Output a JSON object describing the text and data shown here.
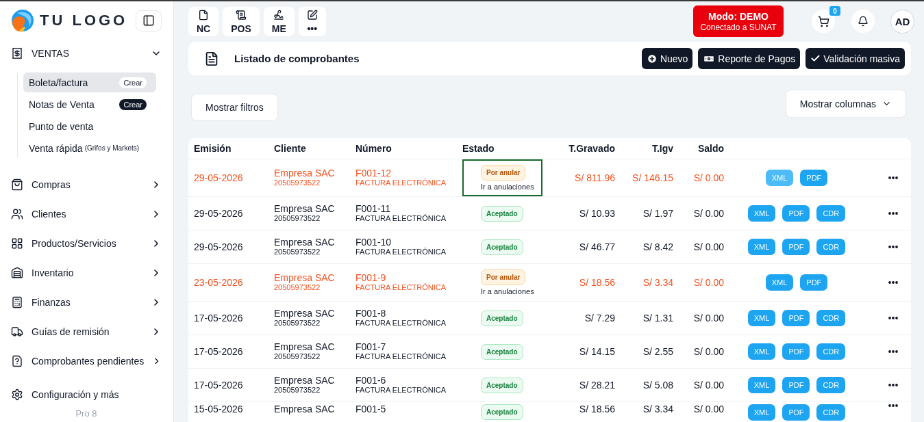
{
  "sidebar": {
    "logo": "TU LOGO",
    "menu": [
      {
        "kind": "group",
        "label": "VENTAS",
        "expanded": true,
        "children": [
          {
            "label": "Boleta/factura",
            "selected": true,
            "badge": "Crear"
          },
          {
            "label": "Notas de Venta",
            "selected": false,
            "badge": "Crear"
          },
          {
            "label": "Punto de venta",
            "selected": false
          },
          {
            "label": "Venta rápida",
            "note": "(Grifos y Markets)",
            "selected": false
          }
        ]
      },
      {
        "kind": "group",
        "label": "Compras",
        "expanded": false
      },
      {
        "kind": "group",
        "label": "Clientes",
        "expanded": false
      },
      {
        "kind": "group",
        "label": "Productos/Servicios",
        "expanded": false
      },
      {
        "kind": "group",
        "label": "Inventario",
        "expanded": false
      },
      {
        "kind": "group",
        "label": "Finanzas",
        "expanded": false
      },
      {
        "kind": "group",
        "label": "Guías de remisión",
        "expanded": false
      },
      {
        "kind": "group",
        "label": "Comprobantes pendientes",
        "expanded": false
      },
      {
        "kind": "link",
        "label": "Configuración y más"
      }
    ],
    "version": "Pro 8"
  },
  "quick_actions": [
    "NC",
    "POS",
    "ME",
    "•••"
  ],
  "mode": {
    "title": "Modo: DEMO",
    "subtitle": "Conectado a SUNAT"
  },
  "cart": {
    "count": "0"
  },
  "user": {
    "initials": "AD"
  },
  "page_header": {
    "title": "Listado de comprobantes",
    "buttons": [
      "Nuevo",
      "Reporte de Pagos",
      "Validación masiva"
    ]
  },
  "filters_button": "Mostrar filtros",
  "columns_button": "Mostrar columnas",
  "table": {
    "columns": [
      "Emisión",
      "Cliente",
      "Número",
      "Estado",
      "T.Gravado",
      "T.Igv",
      "Saldo"
    ],
    "rows": [
      {
        "date": "29-05-2026",
        "client": "Empresa SAC",
        "ruc": "20505973522",
        "number": "F001-12",
        "doc_type": "FACTURA ELECTRÓNICA",
        "status": {
          "kind": "pending",
          "label": "Por anular",
          "link": "Ir a anulaciones",
          "focused": true
        },
        "gravado": "S/ 811.96",
        "igv": "S/ 146.15",
        "saldo": "S/ 0.00",
        "actions": [
          {
            "label": "XML",
            "hovered": true
          },
          {
            "label": "PDF",
            "hovered": false
          }
        ]
      },
      {
        "date": "29-05-2026",
        "client": "Empresa SAC",
        "ruc": "20505973522",
        "number": "F001-11",
        "doc_type": "FACTURA ELECTRÓNICA",
        "status": {
          "kind": "accepted",
          "label": "Aceptado",
          "focused": false
        },
        "gravado": "S/ 10.93",
        "igv": "S/ 1.97",
        "saldo": "S/ 0.00",
        "actions": [
          {
            "label": "XML",
            "hovered": false
          },
          {
            "label": "PDF",
            "hovered": false
          },
          {
            "label": "CDR",
            "hovered": false
          }
        ]
      },
      {
        "date": "29-05-2026",
        "client": "Empresa SAC",
        "ruc": "20505973522",
        "number": "F001-10",
        "doc_type": "FACTURA ELECTRÓNICA",
        "status": {
          "kind": "accepted",
          "label": "Aceptado",
          "focused": false
        },
        "gravado": "S/ 46.77",
        "igv": "S/ 8.42",
        "saldo": "S/ 0.00",
        "actions": [
          {
            "label": "XML",
            "hovered": false
          },
          {
            "label": "PDF",
            "hovered": false
          },
          {
            "label": "CDR",
            "hovered": false
          }
        ]
      },
      {
        "date": "23-05-2026",
        "client": "Empresa SAC",
        "ruc": "20505973522",
        "number": "F001-9",
        "doc_type": "FACTURA ELECTRÓNICA",
        "status": {
          "kind": "pending",
          "label": "Por anular",
          "link": "Ir a anulaciones",
          "focused": false
        },
        "gravado": "S/ 18.56",
        "igv": "S/ 3.34",
        "saldo": "S/ 0.00",
        "actions": [
          {
            "label": "XML",
            "hovered": false
          },
          {
            "label": "PDF",
            "hovered": false
          }
        ]
      },
      {
        "date": "17-05-2026",
        "client": "Empresa SAC",
        "ruc": "20505973522",
        "number": "F001-8",
        "doc_type": "FACTURA ELECTRÓNICA",
        "status": {
          "kind": "accepted",
          "label": "Aceptado",
          "focused": false
        },
        "gravado": "S/ 7.29",
        "igv": "S/ 1.31",
        "saldo": "S/ 0.00",
        "actions": [
          {
            "label": "XML",
            "hovered": false
          },
          {
            "label": "PDF",
            "hovered": false
          },
          {
            "label": "CDR",
            "hovered": false
          }
        ]
      },
      {
        "date": "17-05-2026",
        "client": "Empresa SAC",
        "ruc": "20505973522",
        "number": "F001-7",
        "doc_type": "FACTURA ELECTRÓNICA",
        "status": {
          "kind": "accepted",
          "label": "Aceptado",
          "focused": false
        },
        "gravado": "S/ 14.15",
        "igv": "S/ 2.55",
        "saldo": "S/ 0.00",
        "actions": [
          {
            "label": "XML",
            "hovered": false
          },
          {
            "label": "PDF",
            "hovered": false
          },
          {
            "label": "CDR",
            "hovered": false
          }
        ]
      },
      {
        "date": "17-05-2026",
        "client": "Empresa SAC",
        "ruc": "20505973522",
        "number": "F001-6",
        "doc_type": "FACTURA ELECTRÓNICA",
        "status": {
          "kind": "accepted",
          "label": "Aceptado",
          "focused": false
        },
        "gravado": "S/ 28.21",
        "igv": "S/ 5.08",
        "saldo": "S/ 0.00",
        "actions": [
          {
            "label": "XML",
            "hovered": false
          },
          {
            "label": "PDF",
            "hovered": false
          },
          {
            "label": "CDR",
            "hovered": false
          }
        ]
      },
      {
        "date": "15-05-2026",
        "client": "Empresa SAC",
        "number": "F001-5",
        "status": {
          "kind": "accepted",
          "label": "Aceptado",
          "focused": false
        },
        "gravado": "S/ 18.56",
        "igv": "S/ 3.34",
        "saldo": "S/ 0.00",
        "actions": [
          {
            "label": "XML",
            "hovered": false
          },
          {
            "label": "PDF",
            "hovered": false
          },
          {
            "label": "CDR",
            "hovered": false
          }
        ]
      }
    ]
  }
}
